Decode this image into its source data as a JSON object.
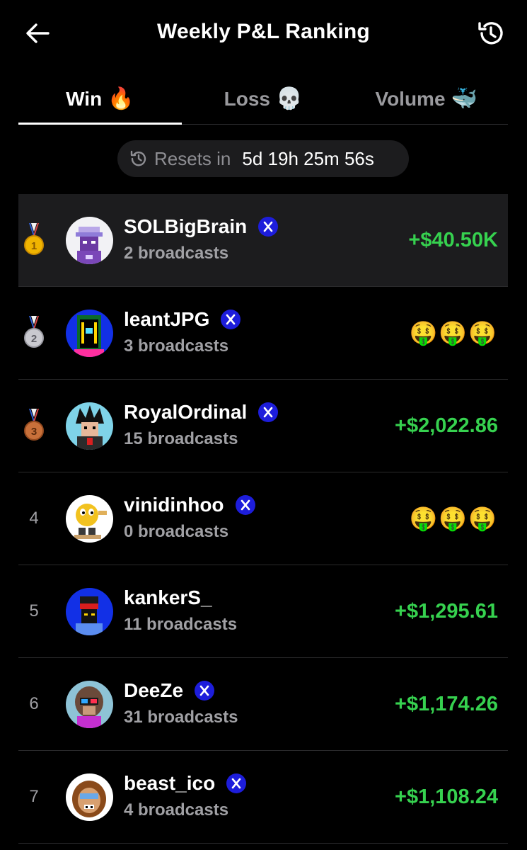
{
  "header": {
    "title": "Weekly P&L Ranking",
    "back_icon": "arrow-left-icon",
    "history_icon": "history-icon"
  },
  "tabs": [
    {
      "label": "Win",
      "emoji": "🔥",
      "active": true
    },
    {
      "label": "Loss",
      "emoji": "💀",
      "active": false
    },
    {
      "label": "Volume",
      "emoji": "🐳",
      "active": false
    }
  ],
  "reset": {
    "label": "Resets in",
    "time": "5d 19h 25m 56s",
    "icon": "timer-reset-icon"
  },
  "colors": {
    "positive": "#36d14f",
    "xbadge": "#1d1ddb",
    "highlight_bg": "#1c1c1e"
  },
  "rows": [
    {
      "rank": "1",
      "medal": "gold",
      "name": "SOLBigBrain",
      "verified": true,
      "broadcasts": "2 broadcasts",
      "pnl": "+$40.50K",
      "pnl_hidden": false,
      "emojis": ""
    },
    {
      "rank": "2",
      "medal": "silver",
      "name": "leantJPG",
      "verified": true,
      "broadcasts": "3 broadcasts",
      "pnl": "",
      "pnl_hidden": true,
      "emojis": "🤑🤑🤑"
    },
    {
      "rank": "3",
      "medal": "bronze",
      "name": "RoyalOrdinal",
      "verified": true,
      "broadcasts": "15 broadcasts",
      "pnl": "+$2,022.86",
      "pnl_hidden": false,
      "emojis": ""
    },
    {
      "rank": "4",
      "medal": "",
      "name": "vinidinhoo",
      "verified": true,
      "broadcasts": "0 broadcasts",
      "pnl": "",
      "pnl_hidden": true,
      "emojis": "🤑🤑🤑"
    },
    {
      "rank": "5",
      "medal": "",
      "name": "kankerS_",
      "verified": false,
      "broadcasts": "11 broadcasts",
      "pnl": "+$1,295.61",
      "pnl_hidden": false,
      "emojis": ""
    },
    {
      "rank": "6",
      "medal": "",
      "name": "DeeZe",
      "verified": true,
      "broadcasts": "31 broadcasts",
      "pnl": "+$1,174.26",
      "pnl_hidden": false,
      "emojis": ""
    },
    {
      "rank": "7",
      "medal": "",
      "name": "beast_ico",
      "verified": true,
      "broadcasts": "4 broadcasts",
      "pnl": "+$1,108.24",
      "pnl_hidden": false,
      "emojis": ""
    }
  ]
}
